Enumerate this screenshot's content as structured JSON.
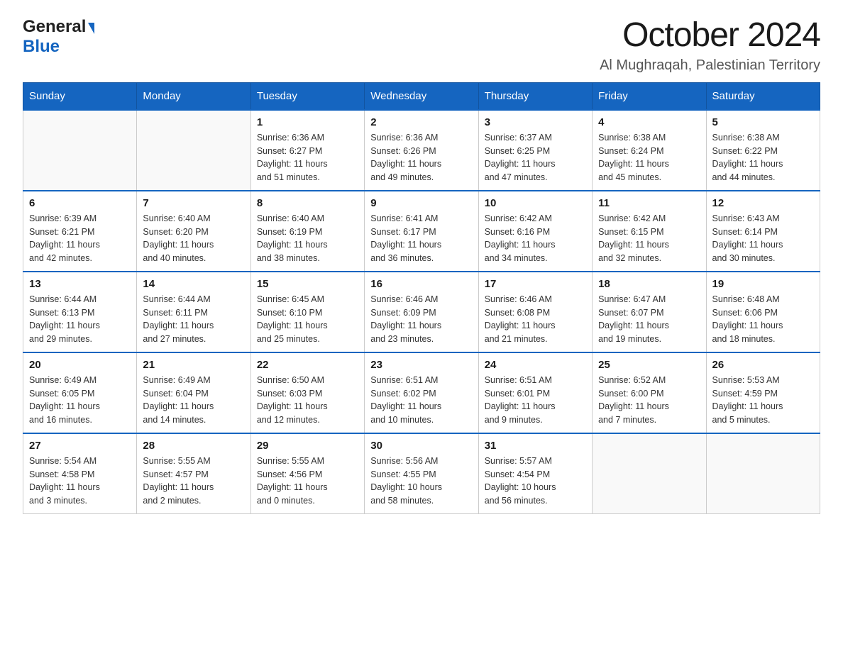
{
  "header": {
    "logo_general": "General",
    "logo_blue": "Blue",
    "title": "October 2024",
    "location": "Al Mughraqah, Palestinian Territory"
  },
  "days_of_week": [
    "Sunday",
    "Monday",
    "Tuesday",
    "Wednesday",
    "Thursday",
    "Friday",
    "Saturday"
  ],
  "weeks": [
    [
      {
        "day": "",
        "info": ""
      },
      {
        "day": "",
        "info": ""
      },
      {
        "day": "1",
        "info": "Sunrise: 6:36 AM\nSunset: 6:27 PM\nDaylight: 11 hours\nand 51 minutes."
      },
      {
        "day": "2",
        "info": "Sunrise: 6:36 AM\nSunset: 6:26 PM\nDaylight: 11 hours\nand 49 minutes."
      },
      {
        "day": "3",
        "info": "Sunrise: 6:37 AM\nSunset: 6:25 PM\nDaylight: 11 hours\nand 47 minutes."
      },
      {
        "day": "4",
        "info": "Sunrise: 6:38 AM\nSunset: 6:24 PM\nDaylight: 11 hours\nand 45 minutes."
      },
      {
        "day": "5",
        "info": "Sunrise: 6:38 AM\nSunset: 6:22 PM\nDaylight: 11 hours\nand 44 minutes."
      }
    ],
    [
      {
        "day": "6",
        "info": "Sunrise: 6:39 AM\nSunset: 6:21 PM\nDaylight: 11 hours\nand 42 minutes."
      },
      {
        "day": "7",
        "info": "Sunrise: 6:40 AM\nSunset: 6:20 PM\nDaylight: 11 hours\nand 40 minutes."
      },
      {
        "day": "8",
        "info": "Sunrise: 6:40 AM\nSunset: 6:19 PM\nDaylight: 11 hours\nand 38 minutes."
      },
      {
        "day": "9",
        "info": "Sunrise: 6:41 AM\nSunset: 6:17 PM\nDaylight: 11 hours\nand 36 minutes."
      },
      {
        "day": "10",
        "info": "Sunrise: 6:42 AM\nSunset: 6:16 PM\nDaylight: 11 hours\nand 34 minutes."
      },
      {
        "day": "11",
        "info": "Sunrise: 6:42 AM\nSunset: 6:15 PM\nDaylight: 11 hours\nand 32 minutes."
      },
      {
        "day": "12",
        "info": "Sunrise: 6:43 AM\nSunset: 6:14 PM\nDaylight: 11 hours\nand 30 minutes."
      }
    ],
    [
      {
        "day": "13",
        "info": "Sunrise: 6:44 AM\nSunset: 6:13 PM\nDaylight: 11 hours\nand 29 minutes."
      },
      {
        "day": "14",
        "info": "Sunrise: 6:44 AM\nSunset: 6:11 PM\nDaylight: 11 hours\nand 27 minutes."
      },
      {
        "day": "15",
        "info": "Sunrise: 6:45 AM\nSunset: 6:10 PM\nDaylight: 11 hours\nand 25 minutes."
      },
      {
        "day": "16",
        "info": "Sunrise: 6:46 AM\nSunset: 6:09 PM\nDaylight: 11 hours\nand 23 minutes."
      },
      {
        "day": "17",
        "info": "Sunrise: 6:46 AM\nSunset: 6:08 PM\nDaylight: 11 hours\nand 21 minutes."
      },
      {
        "day": "18",
        "info": "Sunrise: 6:47 AM\nSunset: 6:07 PM\nDaylight: 11 hours\nand 19 minutes."
      },
      {
        "day": "19",
        "info": "Sunrise: 6:48 AM\nSunset: 6:06 PM\nDaylight: 11 hours\nand 18 minutes."
      }
    ],
    [
      {
        "day": "20",
        "info": "Sunrise: 6:49 AM\nSunset: 6:05 PM\nDaylight: 11 hours\nand 16 minutes."
      },
      {
        "day": "21",
        "info": "Sunrise: 6:49 AM\nSunset: 6:04 PM\nDaylight: 11 hours\nand 14 minutes."
      },
      {
        "day": "22",
        "info": "Sunrise: 6:50 AM\nSunset: 6:03 PM\nDaylight: 11 hours\nand 12 minutes."
      },
      {
        "day": "23",
        "info": "Sunrise: 6:51 AM\nSunset: 6:02 PM\nDaylight: 11 hours\nand 10 minutes."
      },
      {
        "day": "24",
        "info": "Sunrise: 6:51 AM\nSunset: 6:01 PM\nDaylight: 11 hours\nand 9 minutes."
      },
      {
        "day": "25",
        "info": "Sunrise: 6:52 AM\nSunset: 6:00 PM\nDaylight: 11 hours\nand 7 minutes."
      },
      {
        "day": "26",
        "info": "Sunrise: 5:53 AM\nSunset: 4:59 PM\nDaylight: 11 hours\nand 5 minutes."
      }
    ],
    [
      {
        "day": "27",
        "info": "Sunrise: 5:54 AM\nSunset: 4:58 PM\nDaylight: 11 hours\nand 3 minutes."
      },
      {
        "day": "28",
        "info": "Sunrise: 5:55 AM\nSunset: 4:57 PM\nDaylight: 11 hours\nand 2 minutes."
      },
      {
        "day": "29",
        "info": "Sunrise: 5:55 AM\nSunset: 4:56 PM\nDaylight: 11 hours\nand 0 minutes."
      },
      {
        "day": "30",
        "info": "Sunrise: 5:56 AM\nSunset: 4:55 PM\nDaylight: 10 hours\nand 58 minutes."
      },
      {
        "day": "31",
        "info": "Sunrise: 5:57 AM\nSunset: 4:54 PM\nDaylight: 10 hours\nand 56 minutes."
      },
      {
        "day": "",
        "info": ""
      },
      {
        "day": "",
        "info": ""
      }
    ]
  ]
}
